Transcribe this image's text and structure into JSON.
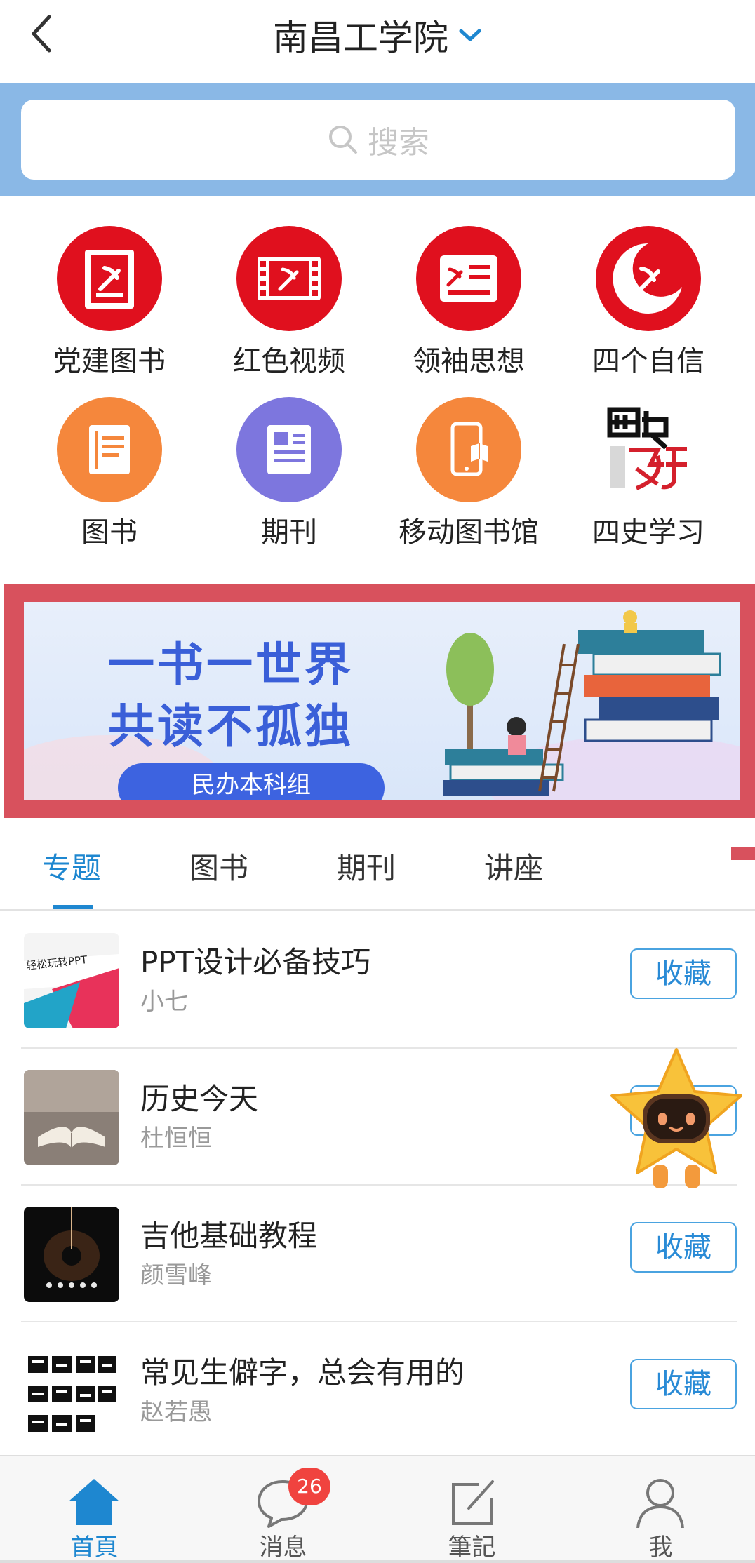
{
  "header": {
    "title": "南昌工学院",
    "back_icon": "back-arrow-icon",
    "dropdown_icon": "chevron-down-icon",
    "accent_color": "#1e87d0"
  },
  "search": {
    "placeholder": "搜索",
    "band_color": "#8ab8e6"
  },
  "quick_links": [
    {
      "label": "党建图书",
      "icon": "party-book-icon",
      "color": "#e0101e"
    },
    {
      "label": "红色视频",
      "icon": "party-film-icon",
      "color": "#e0101e"
    },
    {
      "label": "领袖思想",
      "icon": "party-document-icon",
      "color": "#e0101e"
    },
    {
      "label": "四个自信",
      "icon": "party-emblem-icon",
      "color": "#e0101e"
    },
    {
      "label": "图书",
      "icon": "book-icon",
      "color": "#f5873c"
    },
    {
      "label": "期刊",
      "icon": "periodical-icon",
      "color": "#7d76de"
    },
    {
      "label": "移动图书馆",
      "icon": "mobile-library-icon",
      "color": "#f5873c"
    },
    {
      "label": "四史学习",
      "icon": "four-history-logo",
      "color": "#ffffff"
    }
  ],
  "banner": {
    "line1": "一书一世界",
    "line2": "共读不孤独",
    "pill": "民办本科组",
    "frame_color": "#d8515d"
  },
  "tabs": [
    {
      "label": "专题",
      "active": true
    },
    {
      "label": "图书",
      "active": false
    },
    {
      "label": "期刊",
      "active": false
    },
    {
      "label": "讲座",
      "active": false
    }
  ],
  "list": [
    {
      "title": "PPT设计必备技巧",
      "author": "小七",
      "button": "收藏",
      "thumb_text": "轻松玩转PPT"
    },
    {
      "title": "历史今天",
      "author": "杜恒恒",
      "button": "收藏"
    },
    {
      "title": "吉他基础教程",
      "author": "颜雪峰",
      "button": "收藏"
    },
    {
      "title": "常见生僻字，总会有用的",
      "author": "赵若愚",
      "button": "收藏"
    }
  ],
  "bottom_nav": [
    {
      "label": "首頁",
      "icon": "home-icon",
      "active": true
    },
    {
      "label": "消息",
      "icon": "message-icon",
      "active": false,
      "badge": "26"
    },
    {
      "label": "筆記",
      "icon": "note-icon",
      "active": false
    },
    {
      "label": "我",
      "icon": "profile-icon",
      "active": false
    }
  ]
}
